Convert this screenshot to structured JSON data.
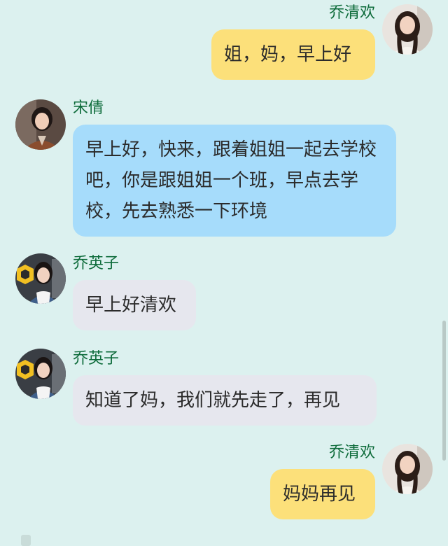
{
  "chat": {
    "messages": [
      {
        "sender": "乔清欢",
        "text": "姐，妈，早上好",
        "side": "right",
        "avatar_icon": "girl-avatar-icon"
      },
      {
        "sender": "宋倩",
        "text": "早上好，快来，跟着姐姐一起去学校吧，你是跟姐姐一个班，早点去学校，先去熟悉一下环境",
        "side": "left",
        "avatar_icon": "woman-avatar-icon"
      },
      {
        "sender": "乔英子",
        "text": "早上好清欢",
        "side": "left",
        "avatar_icon": "student-avatar-icon"
      },
      {
        "sender": "乔英子",
        "text": "知道了妈，我们就先走了，再见",
        "side": "left",
        "avatar_icon": "student-avatar-icon"
      },
      {
        "sender": "乔清欢",
        "text": "妈妈再见",
        "side": "right",
        "avatar_icon": "girl-avatar-icon"
      }
    ]
  },
  "colors": {
    "background": "#dcf1ef",
    "outgoing_bubble": "#fce07a",
    "incoming_blue_bubble": "#a6dcfb",
    "incoming_gray_bubble": "#e6e7ee",
    "name_text": "#0d6b3a"
  }
}
